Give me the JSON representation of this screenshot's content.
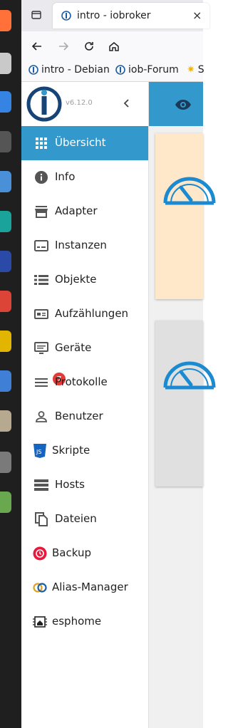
{
  "browser": {
    "tab_title": "intro - iobroker",
    "tab_close": "×",
    "bookmarks": [
      {
        "label": "intro - Debian"
      },
      {
        "label": "iob-Forum"
      },
      {
        "label": "S"
      }
    ]
  },
  "app": {
    "version": "v6.12.0",
    "menu": [
      {
        "label": "Übersicht",
        "icon": "grid-icon",
        "active": true
      },
      {
        "label": "Info",
        "icon": "info-icon"
      },
      {
        "label": "Adapter",
        "icon": "store-icon"
      },
      {
        "label": "Instanzen",
        "icon": "instances-icon"
      },
      {
        "label": "Objekte",
        "icon": "list-icon"
      },
      {
        "label": "Aufzählungen",
        "icon": "enum-icon"
      },
      {
        "label": "Geräte",
        "icon": "devices-icon"
      },
      {
        "label": "Protokolle",
        "icon": "log-icon",
        "badge": "7"
      },
      {
        "label": "Benutzer",
        "icon": "user-icon"
      },
      {
        "label": "Skripte",
        "icon": "js-icon"
      },
      {
        "label": "Hosts",
        "icon": "hosts-icon"
      },
      {
        "label": "Dateien",
        "icon": "files-icon"
      },
      {
        "label": "Backup",
        "icon": "backup-icon"
      },
      {
        "label": "Alias-Manager",
        "icon": "alias-icon"
      },
      {
        "label": "esphome",
        "icon": "esphome-icon"
      }
    ]
  },
  "colors": {
    "accent": "#3399cc",
    "badge": "#e53935",
    "card1": "#ffe7c9",
    "card2": "#e0e0e0"
  }
}
